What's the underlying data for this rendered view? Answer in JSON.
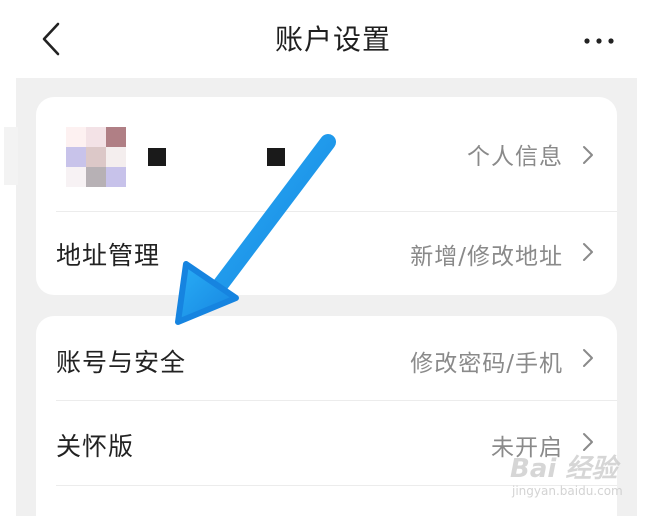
{
  "header": {
    "title": "账户设置",
    "back_icon": "chevron-left-icon",
    "more_icon": "more-horizontal-icon"
  },
  "card_profile": {
    "profile_row_value": "个人信息",
    "address_row": {
      "label": "地址管理",
      "value": "新增/修改地址"
    }
  },
  "card_account": {
    "rows": [
      {
        "label": "账号与安全",
        "value": "修改密码/手机"
      },
      {
        "label": "关怀版",
        "value": "未开启"
      }
    ]
  },
  "annotation": {
    "arrow_color": "#1e9ff2"
  },
  "watermark": {
    "main": "Bai 经验",
    "sub": "jingyan.baidu.com"
  },
  "colors": {
    "background": "#f0f0f0",
    "card": "#ffffff",
    "secondary_text": "#8a8a8a"
  }
}
